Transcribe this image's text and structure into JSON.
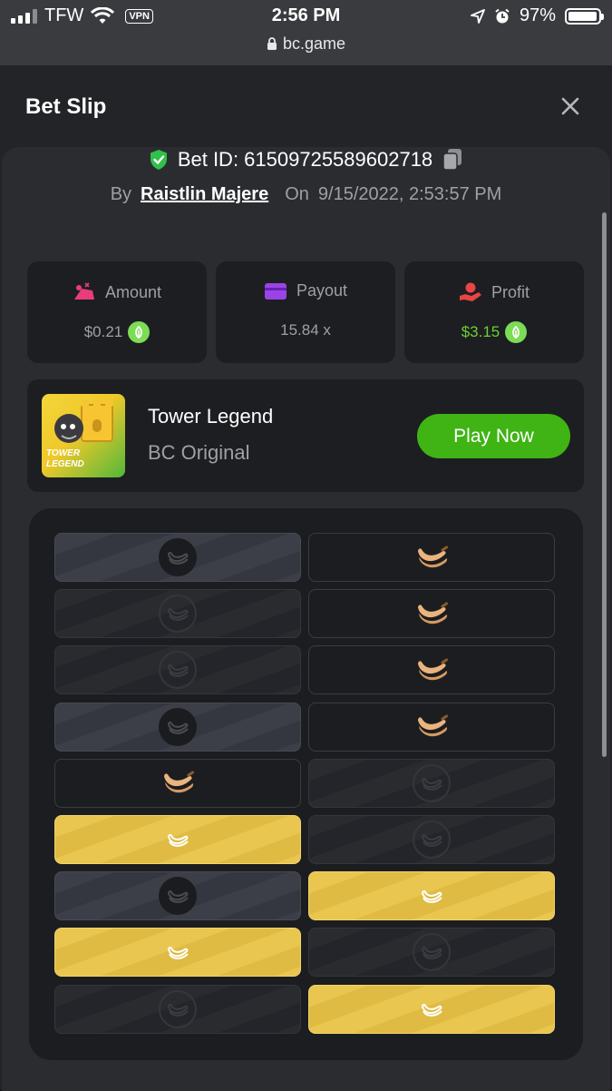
{
  "status": {
    "carrier": "TFW",
    "vpn": "VPN",
    "time": "2:56 PM",
    "battery": "97%",
    "url": "bc.game"
  },
  "header": {
    "title": "Bet Slip"
  },
  "bet": {
    "id_label": "Bet ID: 615097255896​02718",
    "by_label": "By",
    "user": "Raistlin Majere",
    "on_label": "On",
    "datetime": "9/15/2022, 2:53:57 PM"
  },
  "stats": [
    {
      "label": "Amount",
      "value": "$0.21",
      "color": "#e83d7a"
    },
    {
      "label": "Payout",
      "value": "15.84 x",
      "color": "#9b44e6"
    },
    {
      "label": "Profit",
      "value": "$3.15",
      "color": "#e84545"
    }
  ],
  "game": {
    "name": "Tower Legend",
    "subtitle": "BC Original",
    "thumb_text": "TOWER LEGEND",
    "play_label": "Play Now"
  },
  "board": {
    "rows": [
      [
        {
          "style": "slate",
          "icon": "banana-dark"
        },
        {
          "style": "empty",
          "icon": "banana"
        }
      ],
      [
        {
          "style": "darkstripe",
          "icon": "banana-faint"
        },
        {
          "style": "empty",
          "icon": "banana"
        }
      ],
      [
        {
          "style": "darkstripe",
          "icon": "banana-faint"
        },
        {
          "style": "empty",
          "icon": "banana"
        }
      ],
      [
        {
          "style": "slate",
          "icon": "banana-dark"
        },
        {
          "style": "empty",
          "icon": "banana"
        }
      ],
      [
        {
          "style": "empty",
          "icon": "banana"
        },
        {
          "style": "darkstripe",
          "icon": "banana-faint"
        }
      ],
      [
        {
          "style": "gold",
          "icon": "banana-white"
        },
        {
          "style": "darkstripe",
          "icon": "banana-faint"
        }
      ],
      [
        {
          "style": "slate",
          "icon": "banana-dark"
        },
        {
          "style": "gold",
          "icon": "banana-white"
        }
      ],
      [
        {
          "style": "gold",
          "icon": "banana-white"
        },
        {
          "style": "darkstripe",
          "icon": "banana-faint"
        }
      ],
      [
        {
          "style": "darkstripe",
          "icon": "banana-faint"
        },
        {
          "style": "gold",
          "icon": "banana-white"
        }
      ]
    ]
  },
  "colors": {
    "accent_green": "#3fb414",
    "profit_green": "#6bd033",
    "gold_tile": "#e8c650"
  }
}
